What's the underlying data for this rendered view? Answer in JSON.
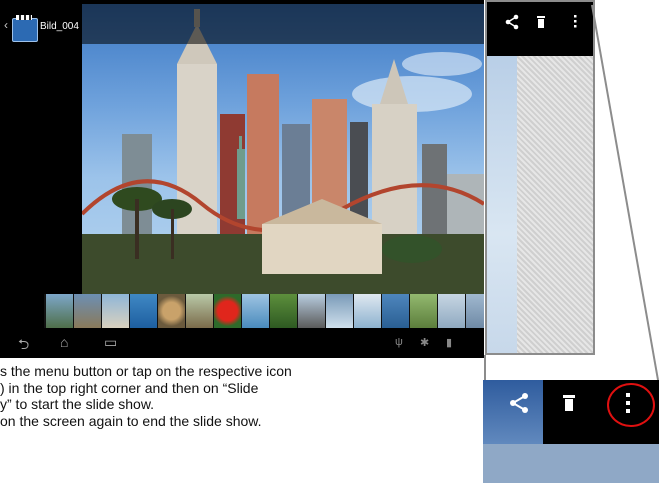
{
  "tablet": {
    "title": "Bild_004",
    "back_glyph": "‹",
    "app_icon": "clapperboard-icon",
    "nav": {
      "back": "⮌",
      "home": "⌂",
      "recent": "▭"
    }
  },
  "zoom_actions": {
    "share_icon": "share-icon",
    "delete_icon": "trash-icon",
    "menu_icon": "overflow-menu-icon"
  },
  "instructions": {
    "line1": "s the menu button or tap on the respective icon",
    "line2": ") in the top right corner and then on “Slide",
    "line3": "y” to start the slide show.",
    "line4": "on the screen again to end the slide show."
  },
  "colors": {
    "highlight": "#e01010",
    "connector": "#8c8c8c"
  }
}
